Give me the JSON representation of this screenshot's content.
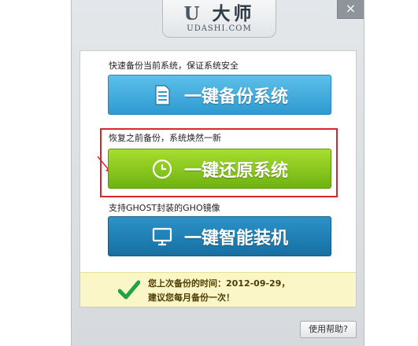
{
  "window": {
    "close_label": "×",
    "logo_text": "大师",
    "logo_letter": "U",
    "domain": "UDASHI.COM"
  },
  "backup": {
    "caption": "快速备份当前系统，保证系统安全",
    "button_label": "一键备份系统",
    "icon": "document-icon"
  },
  "restore": {
    "caption": "恢复之前备份，系统焕然一新",
    "button_label": "一键还原系统",
    "icon": "clock-icon"
  },
  "install": {
    "caption": "支持GHOST封装的GHO镜像",
    "button_label": "一键智能装机",
    "icon": "monitor-icon"
  },
  "info": {
    "line1": "您上次备份的时间：2012-09-29，",
    "line2": "建议您每月备份一次！"
  },
  "help_label": "使用帮助?",
  "colors": {
    "backup": "#2e9ad1",
    "restore": "#6fb212",
    "install": "#166fa3",
    "highlight": "#d9252b",
    "check": "#1ea447"
  }
}
